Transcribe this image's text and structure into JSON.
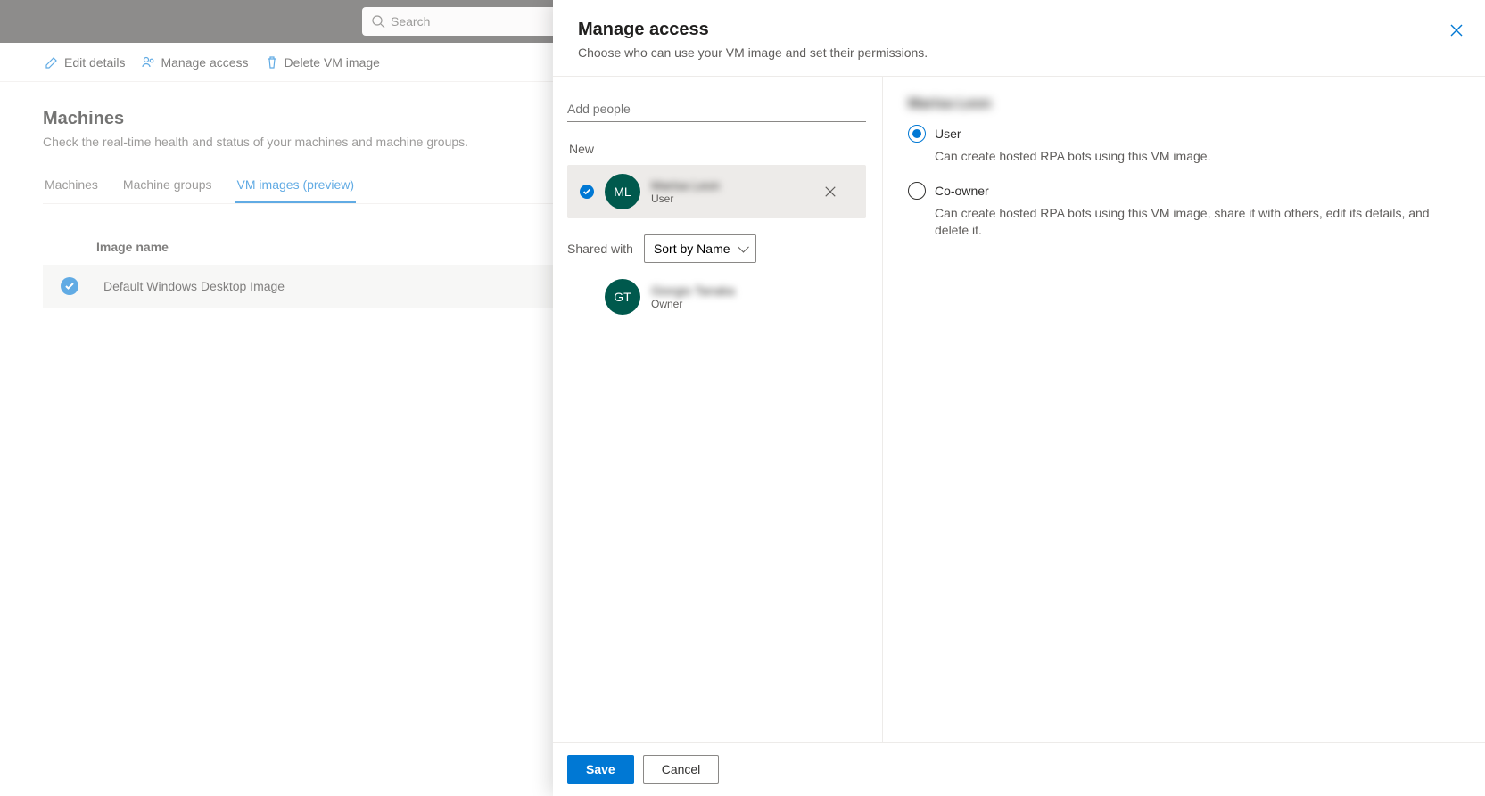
{
  "search": {
    "placeholder": "Search"
  },
  "commands": {
    "edit": "Edit details",
    "manage": "Manage access",
    "delete": "Delete VM image"
  },
  "page": {
    "title": "Machines",
    "subtitle": "Check the real-time health and status of your machines and machine groups."
  },
  "tabs": {
    "machines": "Machines",
    "groups": "Machine groups",
    "vm": "VM images (preview)"
  },
  "table": {
    "col_image_name": "Image name",
    "row0_name": "Default Windows Desktop Image"
  },
  "panel": {
    "title": "Manage access",
    "subtitle": "Choose who can use your VM image and set their permissions.",
    "add_people_placeholder": "Add people",
    "section_new": "New",
    "section_shared": "Shared with",
    "sort_value": "Sort by Name",
    "save": "Save",
    "cancel": "Cancel"
  },
  "people": {
    "new0_avatar": "ML",
    "new0_name": "Marisa Leon",
    "new0_role": "User",
    "shared0_avatar": "GT",
    "shared0_name": "Giorgio Tanaka",
    "shared0_role": "Owner"
  },
  "perm": {
    "selected_name": "Marisa Leon",
    "user_label": "User",
    "user_desc": "Can create hosted RPA bots using this VM image.",
    "coowner_label": "Co-owner",
    "coowner_desc": "Can create hosted RPA bots using this VM image, share it with others, edit its details, and delete it."
  }
}
